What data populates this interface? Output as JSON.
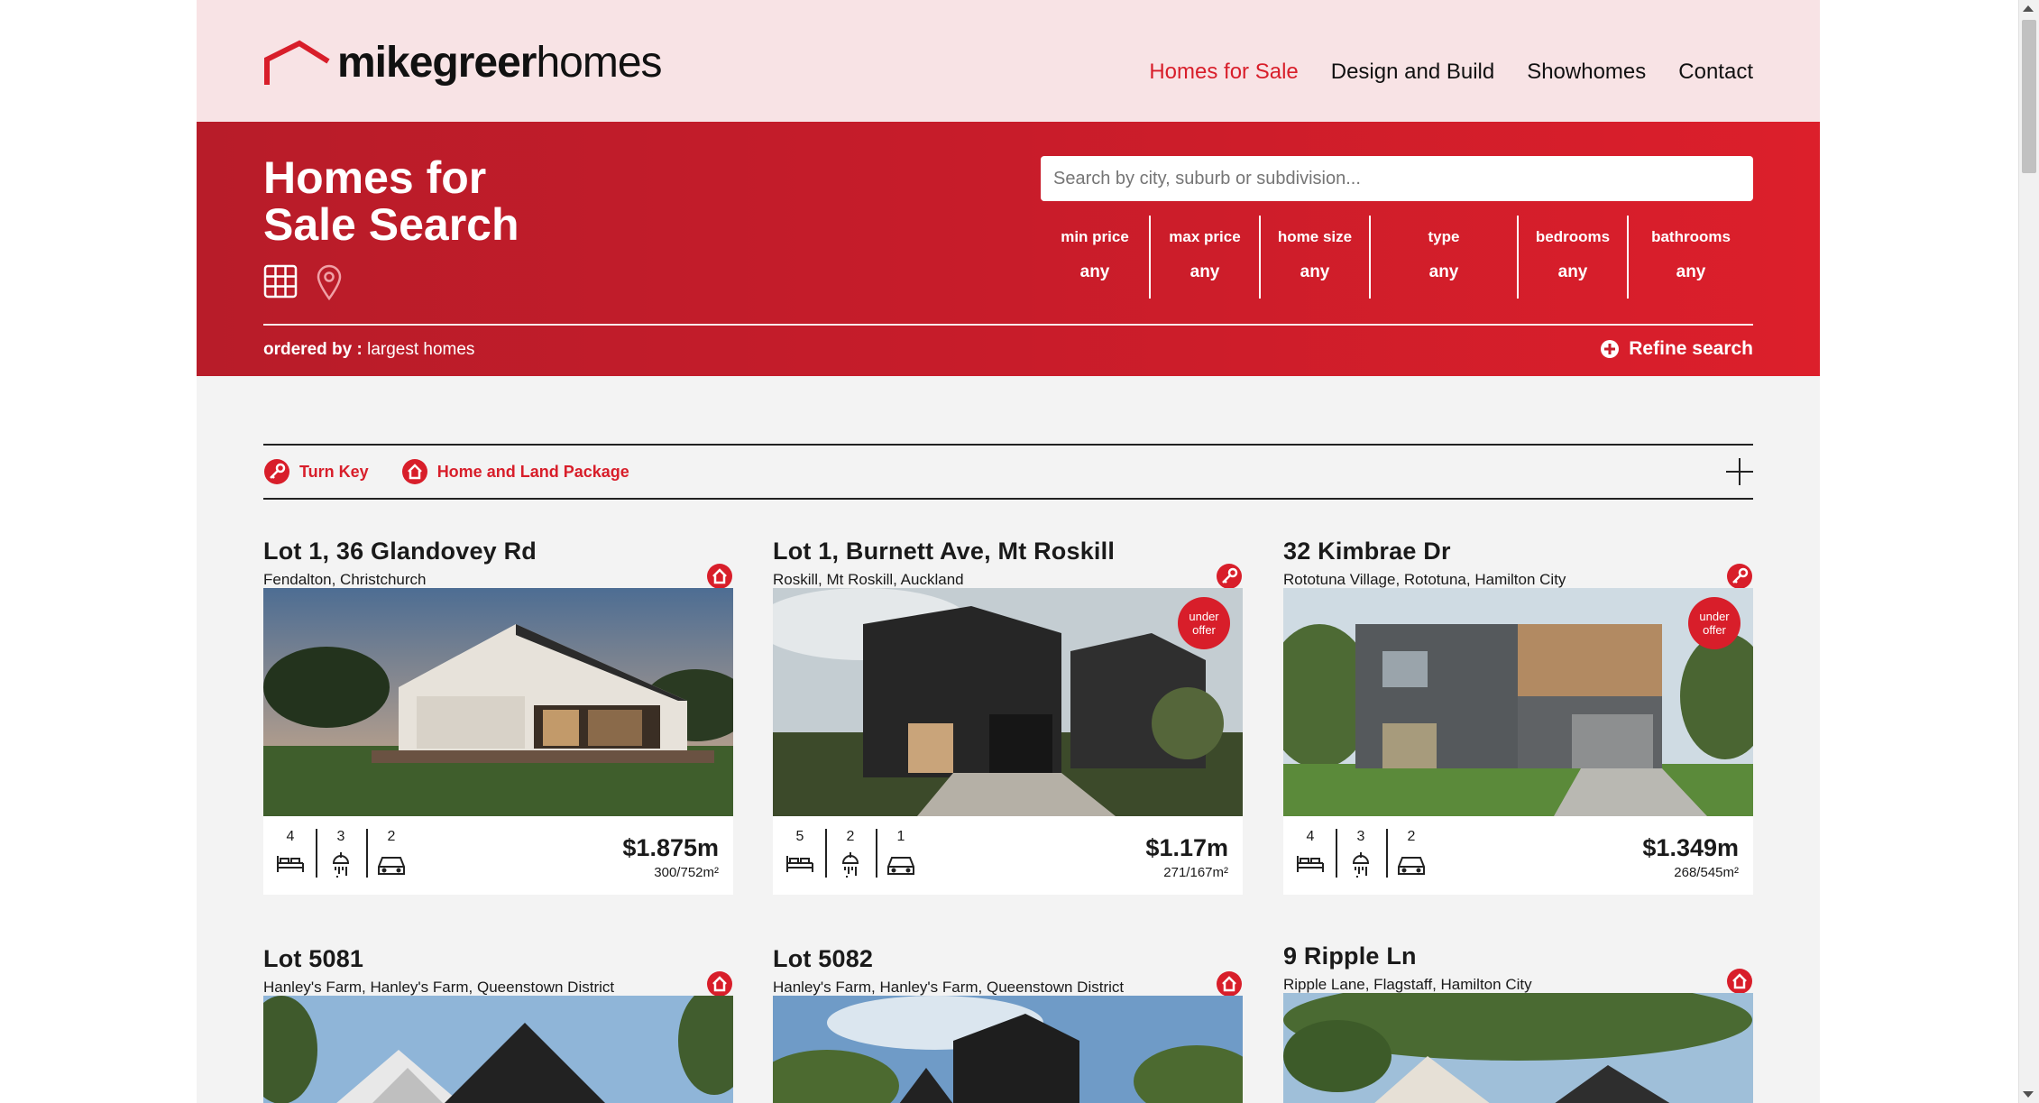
{
  "header": {
    "logo_bold": "mikegreer",
    "logo_light": "homes",
    "nav": [
      "Homes for Sale",
      "Design and Build",
      "Showhomes",
      "Contact"
    ],
    "active_nav": "Homes for Sale"
  },
  "hero": {
    "title": "Homes for Sale Search",
    "search_placeholder": "Search by city, suburb or subdivision...",
    "filters": [
      {
        "label": "min price",
        "value": "any"
      },
      {
        "label": "max price",
        "value": "any"
      },
      {
        "label": "home size",
        "value": "any"
      },
      {
        "label": "type",
        "value": "any"
      },
      {
        "label": "bedrooms",
        "value": "any"
      },
      {
        "label": "bathrooms",
        "value": "any"
      }
    ],
    "ordered_label": "ordered by :",
    "ordered_value": "largest homes",
    "refine_label": "Refine search"
  },
  "legend": {
    "turn_key": "Turn Key",
    "home_land": "Home and Land Package"
  },
  "listings": [
    {
      "title": "Lot 1, 36 Glandovey Rd",
      "subtitle": "Fendalton, Christchurch",
      "type": "home",
      "beds": "4",
      "baths": "3",
      "garage": "2",
      "price": "$1.875m",
      "size": "300/752m²",
      "badge": ""
    },
    {
      "title": "Lot 1, Burnett Ave, Mt Roskill",
      "subtitle": "Roskill, Mt Roskill, Auckland",
      "type": "key",
      "beds": "5",
      "baths": "2",
      "garage": "1",
      "price": "$1.17m",
      "size": "271/167m²",
      "badge": "under offer"
    },
    {
      "title": "32 Kimbrae Dr",
      "subtitle": "Rototuna Village, Rototuna, Hamilton City",
      "type": "key",
      "beds": "4",
      "baths": "3",
      "garage": "2",
      "price": "$1.349m",
      "size": "268/545m²",
      "badge": "under offer"
    },
    {
      "title": "Lot 5081",
      "subtitle": "Hanley's Farm, Hanley's Farm, Queenstown District",
      "type": "home"
    },
    {
      "title": "Lot 5082",
      "subtitle": "Hanley's Farm, Hanley's Farm, Queenstown District",
      "type": "home"
    },
    {
      "title": "9 Ripple Ln",
      "subtitle": "Ripple Lane, Flagstaff, Hamilton City",
      "type": "home"
    }
  ],
  "colors": {
    "brand": "#d81e2a",
    "topbar": "#f8e3e5",
    "background": "#f3f3f3"
  },
  "icons": [
    "home-icon",
    "key-icon",
    "grid-view-icon",
    "map-pin-icon",
    "bed-icon",
    "shower-icon",
    "car-icon",
    "plus-circle-icon",
    "plus-icon"
  ]
}
